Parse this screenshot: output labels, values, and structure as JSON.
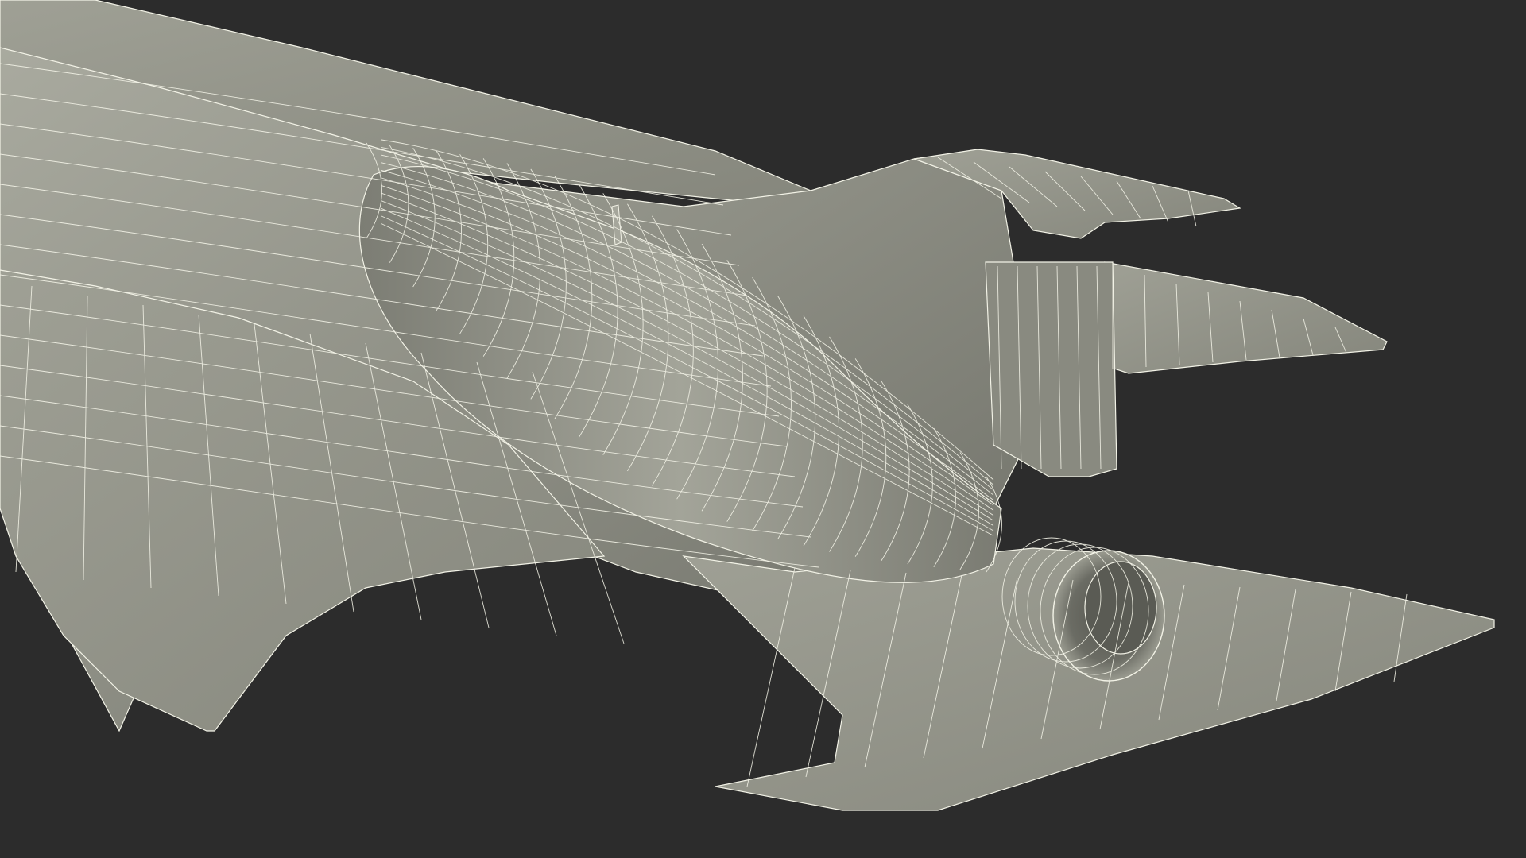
{
  "scene": {
    "subject": "aircraft-wireframe",
    "colors": {
      "background": "#2c2c2c",
      "surface": "#8e8f85",
      "surface_light": "#a6a79c",
      "surface_dark": "#74756c",
      "wire": "#f2f2e6",
      "shadow": "#5d5e57"
    }
  }
}
